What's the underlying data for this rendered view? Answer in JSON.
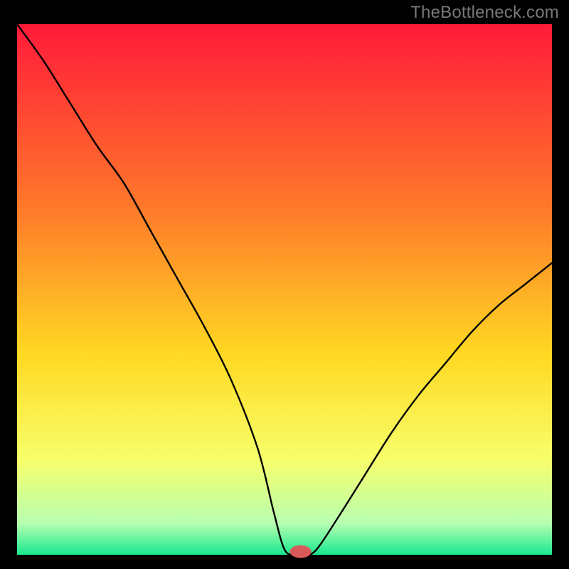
{
  "attribution": "TheBottleneck.com",
  "colors": {
    "frame": "#000000",
    "curve": "#000000",
    "marker_fill": "#d85a58",
    "grad_top": "#ff1a3a",
    "grad_mid1": "#ff7a2a",
    "grad_mid2": "#ffd822",
    "grad_mid3": "#f7ff6a",
    "grad_mid4": "#b8ffb0",
    "grad_bottom": "#18e890"
  },
  "layout": {
    "outer": 800,
    "inner_x": 24,
    "inner_y": 34,
    "inner_w": 752,
    "inner_h": 746
  },
  "chart_data": {
    "type": "line",
    "title": "",
    "xlabel": "",
    "ylabel": "",
    "xlim": [
      0,
      100
    ],
    "ylim": [
      0,
      100
    ],
    "categories_note": "implicit continuous x 0..100",
    "series": [
      {
        "name": "bottleneck-curve",
        "x": [
          0,
          5,
          10,
          15,
          20,
          25,
          30,
          35,
          40,
          45,
          48,
          50,
          52,
          54,
          56,
          60,
          65,
          70,
          75,
          80,
          85,
          90,
          95,
          100
        ],
        "values": [
          100,
          93,
          85,
          77,
          70,
          61,
          52,
          43,
          33,
          20,
          8,
          1,
          0,
          0,
          1,
          7,
          15,
          23,
          30,
          36,
          42,
          47,
          51,
          55
        ]
      }
    ],
    "marker": {
      "x": 53,
      "y": 0.6,
      "rx": 2.0,
      "ry": 1.2
    },
    "gradient_stops": [
      {
        "offset": 0.0,
        "color_key": "grad_top"
      },
      {
        "offset": 0.35,
        "color_key": "grad_mid1"
      },
      {
        "offset": 0.62,
        "color_key": "grad_mid2"
      },
      {
        "offset": 0.82,
        "color_key": "grad_mid3"
      },
      {
        "offset": 0.94,
        "color_key": "grad_mid4"
      },
      {
        "offset": 1.0,
        "color_key": "grad_bottom"
      }
    ]
  }
}
